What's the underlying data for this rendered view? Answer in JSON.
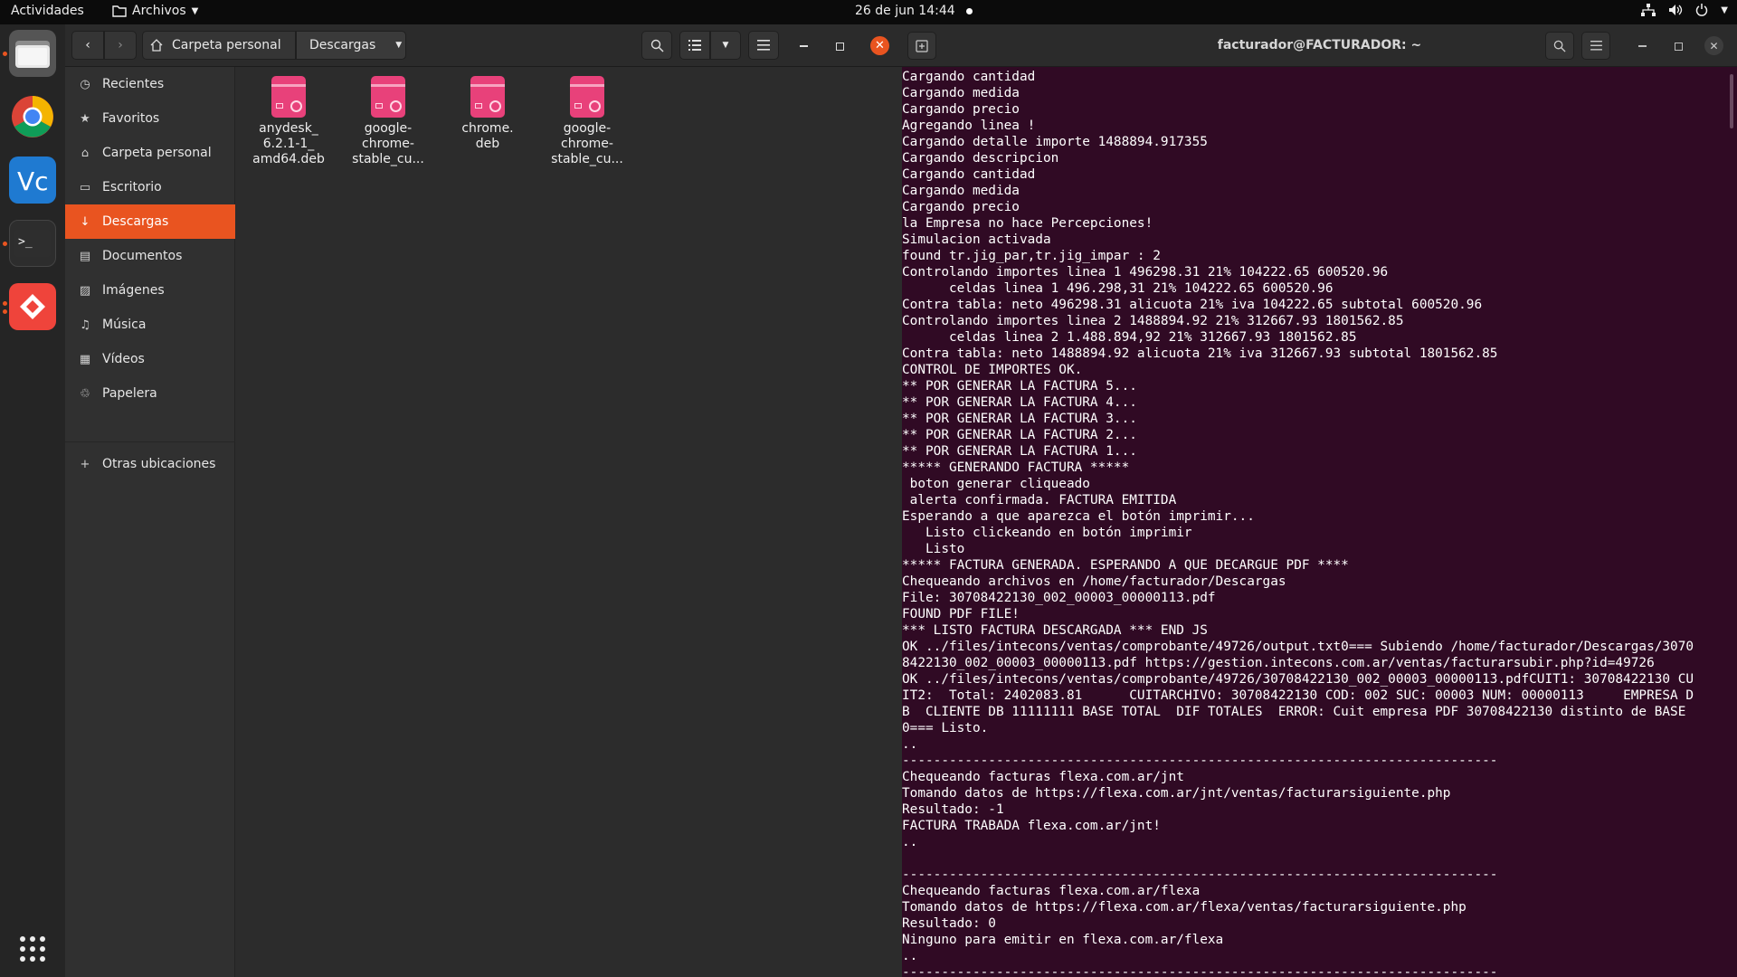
{
  "topbar": {
    "activities": "Actividades",
    "app_name": "Archivos",
    "clock": "26 de jun  14:44"
  },
  "dock": {
    "items": [
      "files-icon",
      "chrome-icon",
      "vscode-icon",
      "terminal-icon",
      "anydesk-icon",
      "app-grid-icon"
    ]
  },
  "files": {
    "path": [
      "Carpeta personal",
      "Descargas"
    ],
    "sidebar": [
      {
        "label": "Recientes",
        "icon": "clock-icon"
      },
      {
        "label": "Favoritos",
        "icon": "star-icon"
      },
      {
        "label": "Carpeta personal",
        "icon": "home-icon"
      },
      {
        "label": "Escritorio",
        "icon": "desktop-icon"
      },
      {
        "label": "Descargas",
        "icon": "download-icon"
      },
      {
        "label": "Documentos",
        "icon": "document-icon"
      },
      {
        "label": "Imágenes",
        "icon": "image-icon"
      },
      {
        "label": "Música",
        "icon": "music-icon"
      },
      {
        "label": "Vídeos",
        "icon": "video-icon"
      },
      {
        "label": "Papelera",
        "icon": "trash-icon"
      },
      {
        "label": "Otras ubicaciones",
        "icon": "plus-icon"
      }
    ],
    "active_sidebar": "Descargas",
    "files": [
      {
        "name": "anydesk_\n6.2.1-1_\namd64.deb"
      },
      {
        "name": "google-\nchrome-\nstable_cu..."
      },
      {
        "name": "chrome.\ndeb"
      },
      {
        "name": "google-\nchrome-\nstable_cu..."
      }
    ]
  },
  "terminal": {
    "title": "facturador@FACTURADOR: ~",
    "lines": [
      "Cargando cantidad",
      "Cargando medida",
      "Cargando precio",
      "Agregando linea !",
      "Cargando detalle importe 1488894.917355",
      "Cargando descripcion",
      "Cargando cantidad",
      "Cargando medida",
      "Cargando precio",
      "la Empresa no hace Percepciones!",
      "Simulacion activada",
      "found tr.jig_par,tr.jig_impar : 2",
      "Controlando importes linea 1 496298.31 21% 104222.65 600520.96",
      "      celdas linea 1 496.298,31 21% 104222.65 600520.96",
      "Contra tabla: neto 496298.31 alicuota 21% iva 104222.65 subtotal 600520.96",
      "Controlando importes linea 2 1488894.92 21% 312667.93 1801562.85",
      "      celdas linea 2 1.488.894,92 21% 312667.93 1801562.85",
      "Contra tabla: neto 1488894.92 alicuota 21% iva 312667.93 subtotal 1801562.85",
      "CONTROL DE IMPORTES OK.",
      "** POR GENERAR LA FACTURA 5...",
      "** POR GENERAR LA FACTURA 4...",
      "** POR GENERAR LA FACTURA 3...",
      "** POR GENERAR LA FACTURA 2...",
      "** POR GENERAR LA FACTURA 1...",
      "***** GENERANDO FACTURA *****",
      " boton generar cliqueado",
      " alerta confirmada. FACTURA EMITIDA",
      "Esperando a que aparezca el botón imprimir...",
      "   Listo clickeando en botón imprimir",
      "   Listo",
      "***** FACTURA GENERADA. ESPERANDO A QUE DECARGUE PDF ****",
      "Chequeando archivos en /home/facturador/Descargas",
      "File: 30708422130_002_00003_00000113.pdf",
      "FOUND PDF FILE!",
      "*** LISTO FACTURA DESCARGADA *** END JS",
      "OK ../files/intecons/ventas/comprobante/49726/output.txt0=== Subiendo /home/facturador/Descargas/3070",
      "8422130_002_00003_00000113.pdf https://gestion.intecons.com.ar/ventas/facturarsubir.php?id=49726",
      "OK ../files/intecons/ventas/comprobante/49726/30708422130_002_00003_00000113.pdfCUIT1: 30708422130 CU",
      "IT2:  Total: 2402083.81      CUITARCHIVO: 30708422130 COD: 002 SUC: 00003 NUM: 00000113     EMPRESA D",
      "B  CLIENTE DB 11111111 BASE TOTAL  DIF TOTALES  ERROR: Cuit empresa PDF 30708422130 distinto de BASE",
      "0=== Listo.",
      "..",
      "----------------------------------------------------------------------------",
      "Chequeando facturas flexa.com.ar/jnt",
      "Tomando datos de https://flexa.com.ar/jnt/ventas/facturarsiguiente.php",
      "Resultado: -1",
      "FACTURA TRABADA flexa.com.ar/jnt!",
      "..",
      "",
      "----------------------------------------------------------------------------",
      "Chequeando facturas flexa.com.ar/flexa",
      "Tomando datos de https://flexa.com.ar/flexa/ventas/facturarsiguiente.php",
      "Resultado: 0",
      "Ninguno para emitir en flexa.com.ar/flexa",
      "..",
      "----------------------------------------------------------------------------"
    ]
  },
  "colors": {
    "accent": "#e95420",
    "terminal_bg": "#300a24",
    "deb_icon": "#e8417a"
  }
}
